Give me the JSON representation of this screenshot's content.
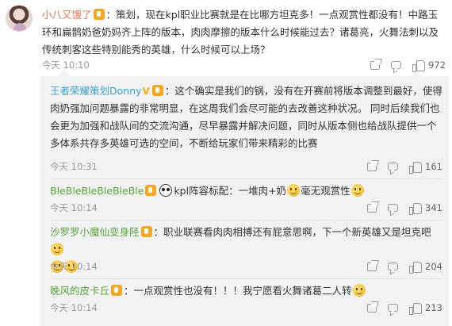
{
  "top": {
    "username": "小八又饿了",
    "text": "：策划，现在kpl职业比赛就是在比哪方坦克多！一点观赏性都没有！中路玉环和扁鹊奶爸奶妈齐上阵的版本，肉肉摩擦的版本什么时候能过去？诸葛亮，火舞法刺以及传统刺客这些特别能秀的英雄，什么时候可以上场？",
    "time": "今天 10:10",
    "like_count": "972"
  },
  "replies": [
    {
      "username": "王者荣耀策划Donny",
      "text": "：这个确实是我们的锅，没有在开赛前将版本调整到最好，使得肉奶强加问题暴露的非常明显，在这周我们会尽可能的去改善这种状况。 同时后续我们也会更为加强和战队间的交流沟通，尽早暴露并解决问题，同时从版本侧也给战队提供一个多体系共存多英雄可选的空间，不断给玩家们带来精彩的比赛",
      "time": "今天 10:31",
      "like_count": "161"
    },
    {
      "username": "BleBleBleBleBleBle",
      "text_a": "kpl阵容标配：一堆肉+奶",
      "text_b": "毫无观赏性",
      "time": "今天 10:14",
      "like_count": "341"
    },
    {
      "username": "沙罗罗小魔仙变身陉",
      "text": "：职业联赛看肉肉相搏还有屁意思啊，下一个新英雄又是坦克吧",
      "time": "今天 10:14",
      "like_count": "204"
    },
    {
      "username": "晚风的皮卡丘",
      "text": "：一点观赏性也没有！！！我宁愿看火舞诸葛二人转",
      "time": "今天 10:14",
      "like_count": "213"
    }
  ],
  "icons": {
    "share": "share-icon",
    "comment": "comment-icon",
    "like": "like-icon"
  },
  "colors": {
    "top_username": "#eb7350",
    "reply_username": "#5aa537",
    "reply_bg": "#f2f2f5",
    "meta": "#999999"
  }
}
